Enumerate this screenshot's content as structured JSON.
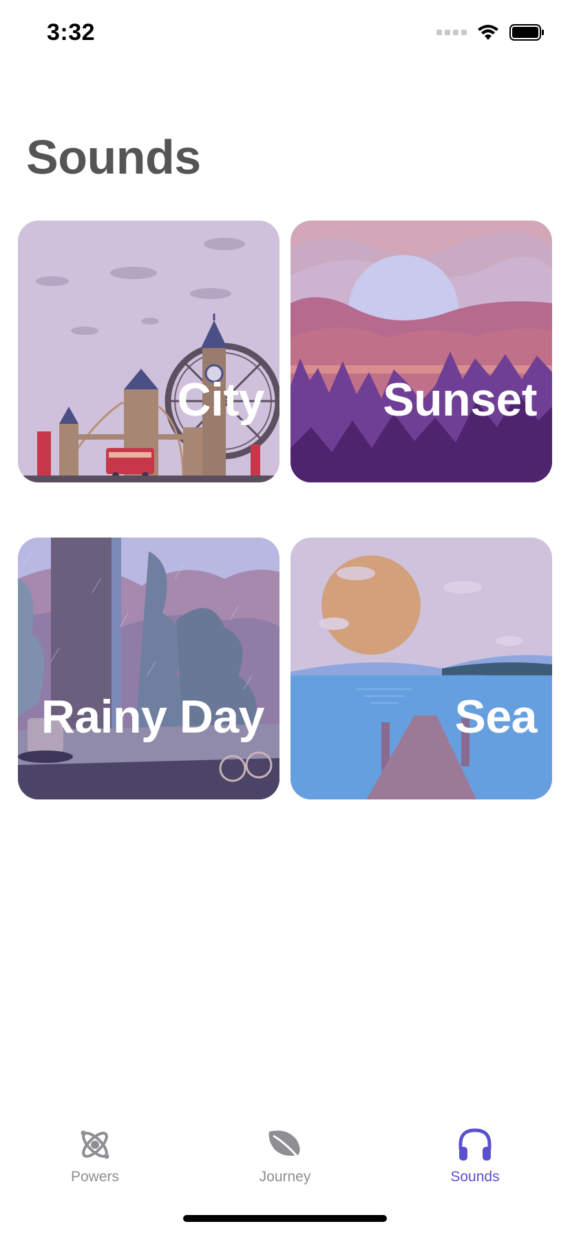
{
  "status_bar": {
    "time": "3:32"
  },
  "page": {
    "title": "Sounds"
  },
  "cards": [
    {
      "label": "City",
      "scene": "london-skyline"
    },
    {
      "label": "Sunset",
      "scene": "mountain-forest-sunset"
    },
    {
      "label": "Rainy Day",
      "scene": "rainy-window"
    },
    {
      "label": "Sea",
      "scene": "sea-pier"
    }
  ],
  "tab_bar": {
    "items": [
      {
        "label": "Powers",
        "icon": "atom-icon",
        "active": false
      },
      {
        "label": "Journey",
        "icon": "leaf-icon",
        "active": false
      },
      {
        "label": "Sounds",
        "icon": "headphones-icon",
        "active": true
      }
    ]
  },
  "colors": {
    "title": "#555555",
    "active_tab": "#5a4fcf",
    "inactive_tab": "#8e8e93"
  }
}
